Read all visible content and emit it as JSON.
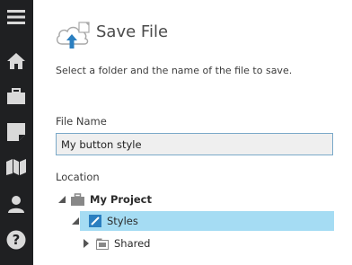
{
  "sidebar": {
    "items": [
      {
        "icon": "hamburger-menu-icon"
      },
      {
        "icon": "home-icon"
      },
      {
        "icon": "briefcase-icon"
      },
      {
        "icon": "note-icon"
      },
      {
        "icon": "map-icon"
      },
      {
        "icon": "user-icon"
      },
      {
        "icon": "help-icon"
      }
    ],
    "background": "#1f2022",
    "icon_color": "#d9d9d9"
  },
  "header": {
    "icon": "cloud-upload-icon",
    "title": "Save File",
    "subtitle": "Select a folder and the name of the file to save."
  },
  "file_name": {
    "label": "File Name",
    "value": "My button style"
  },
  "location": {
    "label": "Location",
    "tree": [
      {
        "label": "My Project",
        "expanded": true,
        "icon": "briefcase-icon"
      },
      {
        "label": "Styles",
        "expanded": true,
        "selected": true,
        "icon": "styles-folder-icon"
      },
      {
        "label": "Shared",
        "expanded": false,
        "icon": "folder-icon"
      }
    ]
  },
  "colors": {
    "accent": "#2b7fc0",
    "selection": "#a5dcf3",
    "input_border": "#7aa9c9"
  }
}
